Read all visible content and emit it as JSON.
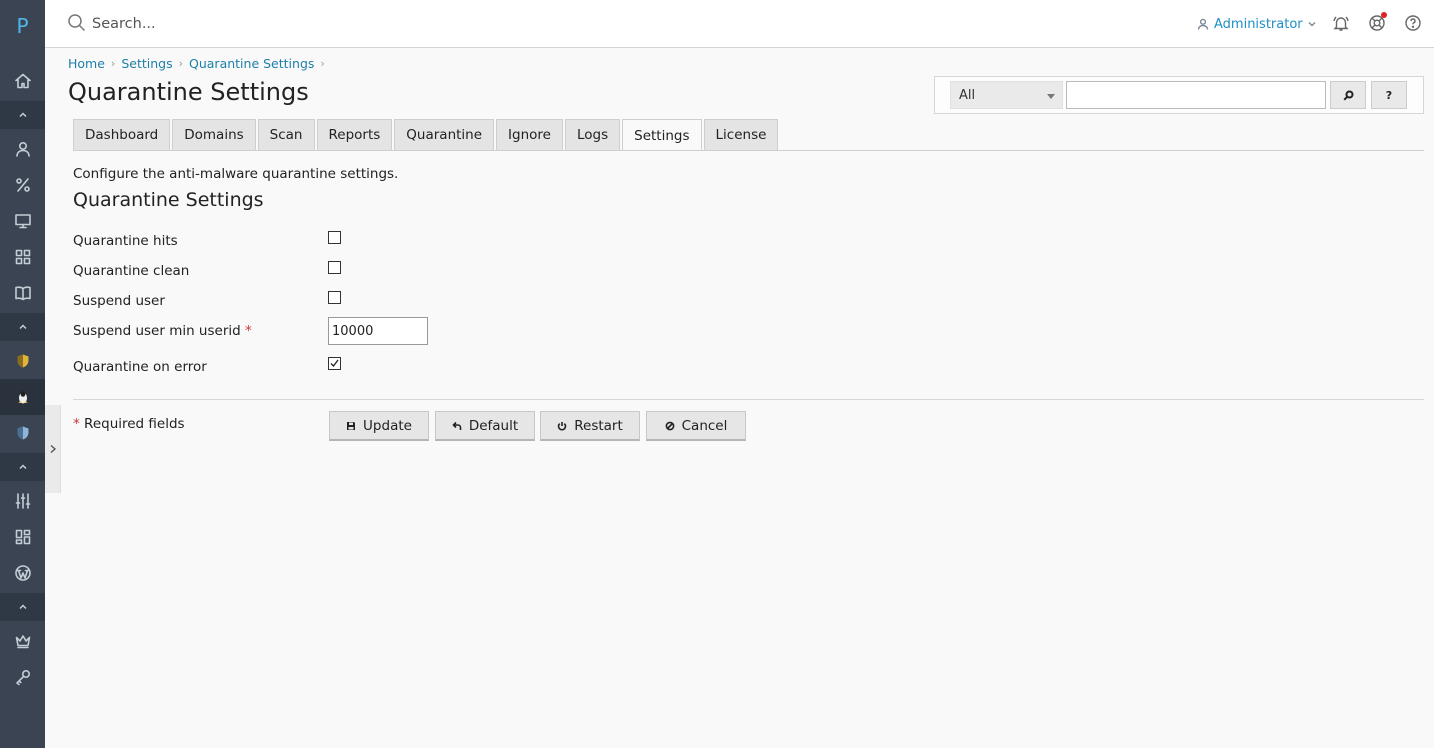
{
  "sidebar": {
    "logo": "P",
    "items": [
      {
        "name": "home-icon"
      },
      {
        "name": "user-icon"
      },
      {
        "name": "percent-icon"
      },
      {
        "name": "monitor-icon"
      },
      {
        "name": "grid-icon"
      },
      {
        "name": "book-icon"
      },
      {
        "name": "shield-yellow-icon"
      },
      {
        "name": "linux-icon"
      },
      {
        "name": "shield-blue-icon"
      },
      {
        "name": "sliders-icon"
      },
      {
        "name": "layout-icon"
      },
      {
        "name": "wordpress-icon"
      },
      {
        "name": "crown-icon"
      },
      {
        "name": "key-icon"
      }
    ]
  },
  "topbar": {
    "search_placeholder": "Search...",
    "user_label": "Administrator"
  },
  "breadcrumb": [
    "Home",
    "Settings",
    "Quarantine Settings"
  ],
  "page_title": "Quarantine Settings",
  "filter": {
    "selected": "All",
    "search_value": "",
    "help_label": "?"
  },
  "tabs": [
    "Dashboard",
    "Domains",
    "Scan",
    "Reports",
    "Quarantine",
    "Ignore",
    "Logs",
    "Settings",
    "License"
  ],
  "active_tab": "Settings",
  "description": "Configure the anti-malware quarantine settings.",
  "section_title": "Quarantine Settings",
  "fields": {
    "quarantine_hits": {
      "label": "Quarantine hits",
      "checked": false
    },
    "quarantine_clean": {
      "label": "Quarantine clean",
      "checked": false
    },
    "suspend_user": {
      "label": "Suspend user",
      "checked": false
    },
    "suspend_user_min_userid": {
      "label": "Suspend user min userid",
      "required_mark": "*",
      "value": "10000"
    },
    "quarantine_on_error": {
      "label": "Quarantine on error",
      "checked": true
    }
  },
  "required_note": {
    "mark": "*",
    "text": "Required fields"
  },
  "buttons": {
    "update": "Update",
    "default": "Default",
    "restart": "Restart",
    "cancel": "Cancel"
  },
  "colors": {
    "sidebar_bg": "#3a4452",
    "link": "#1d7fa8",
    "accent": "#4fb6e7",
    "required": "#cc3333"
  }
}
